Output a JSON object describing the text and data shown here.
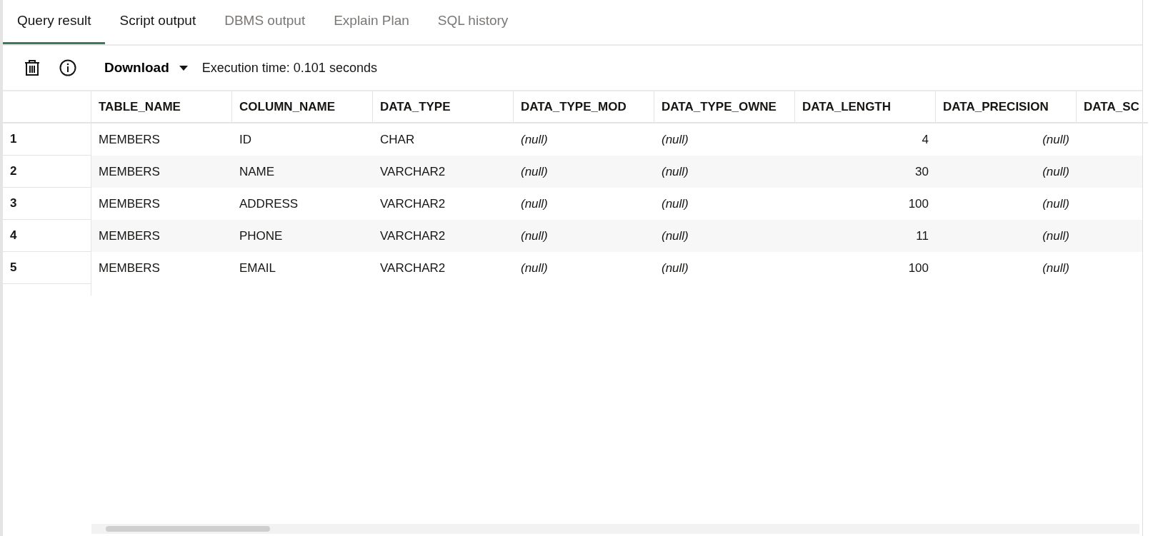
{
  "tabs": [
    {
      "label": "Query result",
      "selected": true,
      "disabled": false
    },
    {
      "label": "Script output",
      "selected": false,
      "disabled": false
    },
    {
      "label": "DBMS output",
      "selected": false,
      "disabled": true
    },
    {
      "label": "Explain Plan",
      "selected": false,
      "disabled": true
    },
    {
      "label": "SQL history",
      "selected": false,
      "disabled": true
    }
  ],
  "toolbar": {
    "download": "Download",
    "execution_time": "Execution time: 0.101 seconds"
  },
  "table": {
    "columns": [
      {
        "label": "TABLE_NAME",
        "numeric": false
      },
      {
        "label": "COLUMN_NAME",
        "numeric": false
      },
      {
        "label": "DATA_TYPE",
        "numeric": false
      },
      {
        "label": "DATA_TYPE_MOD",
        "numeric": false
      },
      {
        "label": "DATA_TYPE_OWNE",
        "numeric": false
      },
      {
        "label": "DATA_LENGTH",
        "numeric": true
      },
      {
        "label": "DATA_PRECISION",
        "numeric": true
      },
      {
        "label": "DATA_SC"
      }
    ],
    "rows": [
      {
        "number": "1",
        "cells": [
          {
            "text": "MEMBERS",
            "kind": "value"
          },
          {
            "text": "ID",
            "kind": "value"
          },
          {
            "text": "CHAR",
            "kind": "value"
          },
          {
            "text": "(null)",
            "kind": "null"
          },
          {
            "text": "(null)",
            "kind": "null"
          },
          {
            "text": "4",
            "kind": "value"
          },
          {
            "text": "(null)",
            "kind": "null"
          }
        ]
      },
      {
        "number": "2",
        "cells": [
          {
            "text": "MEMBERS",
            "kind": "value"
          },
          {
            "text": "NAME",
            "kind": "value"
          },
          {
            "text": "VARCHAR2",
            "kind": "value"
          },
          {
            "text": "(null)",
            "kind": "null"
          },
          {
            "text": "(null)",
            "kind": "null"
          },
          {
            "text": "30",
            "kind": "value"
          },
          {
            "text": "(null)",
            "kind": "null"
          }
        ]
      },
      {
        "number": "3",
        "cells": [
          {
            "text": "MEMBERS",
            "kind": "value"
          },
          {
            "text": "ADDRESS",
            "kind": "value"
          },
          {
            "text": "VARCHAR2",
            "kind": "value"
          },
          {
            "text": "(null)",
            "kind": "null"
          },
          {
            "text": "(null)",
            "kind": "null"
          },
          {
            "text": "100",
            "kind": "value"
          },
          {
            "text": "(null)",
            "kind": "null"
          }
        ]
      },
      {
        "number": "4",
        "cells": [
          {
            "text": "MEMBERS",
            "kind": "value"
          },
          {
            "text": "PHONE",
            "kind": "value"
          },
          {
            "text": "VARCHAR2",
            "kind": "value"
          },
          {
            "text": "(null)",
            "kind": "null"
          },
          {
            "text": "(null)",
            "kind": "null"
          },
          {
            "text": "11",
            "kind": "value"
          },
          {
            "text": "(null)",
            "kind": "null"
          }
        ]
      },
      {
        "number": "5",
        "cells": [
          {
            "text": "MEMBERS",
            "kind": "value"
          },
          {
            "text": "EMAIL",
            "kind": "value"
          },
          {
            "text": "VARCHAR2",
            "kind": "value"
          },
          {
            "text": "(null)",
            "kind": "null"
          },
          {
            "text": "(null)",
            "kind": "null"
          },
          {
            "text": "100",
            "kind": "value"
          },
          {
            "text": "(null)",
            "kind": "null"
          }
        ]
      }
    ]
  }
}
